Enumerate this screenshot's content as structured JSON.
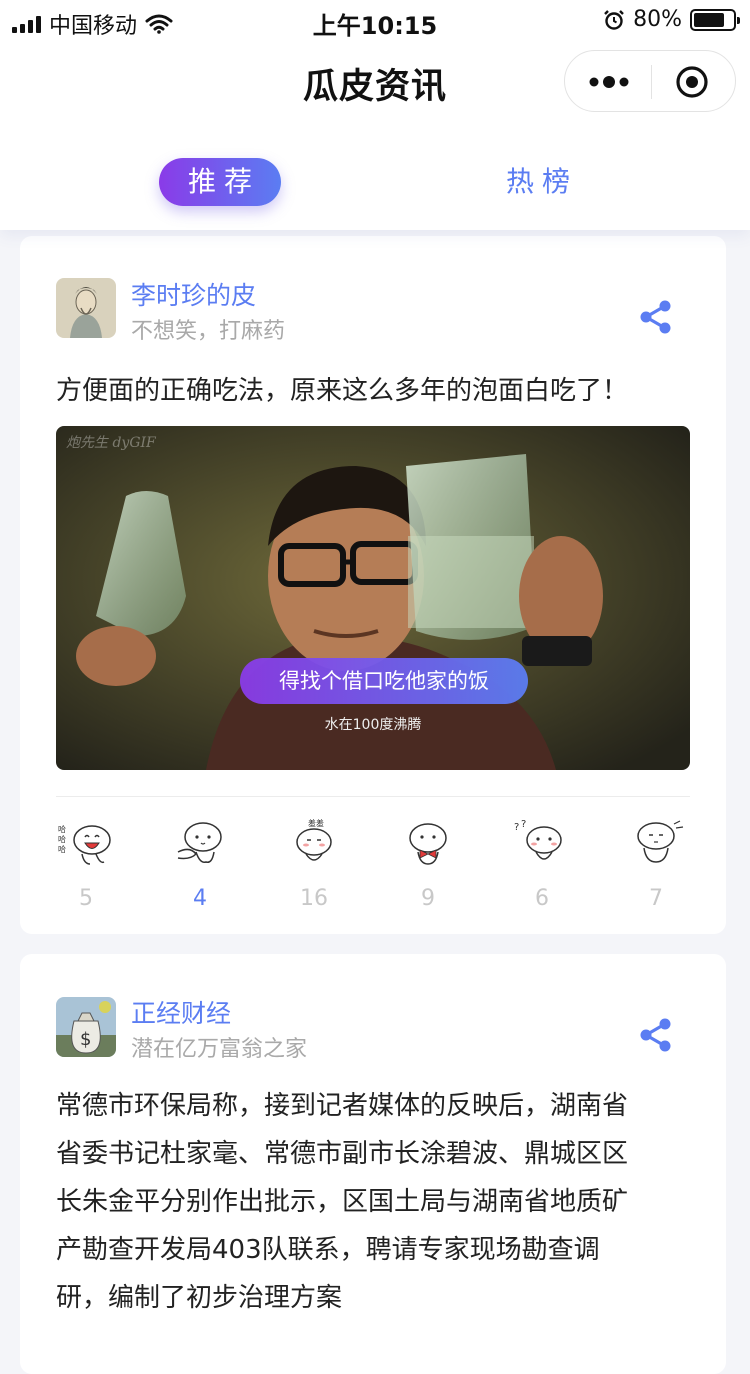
{
  "status_bar": {
    "carrier": "中国移动",
    "time": "上午10:15",
    "battery": "80%",
    "battery_level": 0.8
  },
  "nav": {
    "title": "瓜皮资讯"
  },
  "tabs": [
    {
      "label": "推荐",
      "active": true
    },
    {
      "label": "热榜",
      "active": false
    }
  ],
  "colors": {
    "accent": "#5b7df2",
    "gradient_start": "#8a3be8",
    "gradient_end": "#5b7df2",
    "muted": "#a9a9a9"
  },
  "posts": [
    {
      "author": "李时珍的皮",
      "subtitle": "不想笑，打麻药",
      "title": "方便面的正确吃法，原来这么多年的泡面白吃了！",
      "media": {
        "watermark": "炮先生 dyGIF",
        "overlay": "得找个借口吃他家的饭",
        "caption": "水在100度沸腾"
      },
      "reactions": [
        {
          "icon": "haha-emoji-icon",
          "count": "5"
        },
        {
          "icon": "clap-emoji-icon",
          "count": "4",
          "highlight": true
        },
        {
          "icon": "shy-emoji-icon",
          "count": "16"
        },
        {
          "icon": "bowtie-emoji-icon",
          "count": "9"
        },
        {
          "icon": "confused-emoji-icon",
          "count": "6"
        },
        {
          "icon": "sweat-emoji-icon",
          "count": "7"
        }
      ]
    },
    {
      "author": "正经财经",
      "subtitle": "潜在亿万富翁之家",
      "title_lines": [
        "常德市环保局称，接到记者媒体的反映后，湖南省",
        "省委书记杜家毫、常德市副市长涂碧波、鼎城区区",
        "长朱金平分别作出批示，区国土局与湖南省地质矿",
        "产勘查开发局403队联系，聘请专家现场勘查调",
        "研，编制了初步治理方案"
      ]
    }
  ]
}
